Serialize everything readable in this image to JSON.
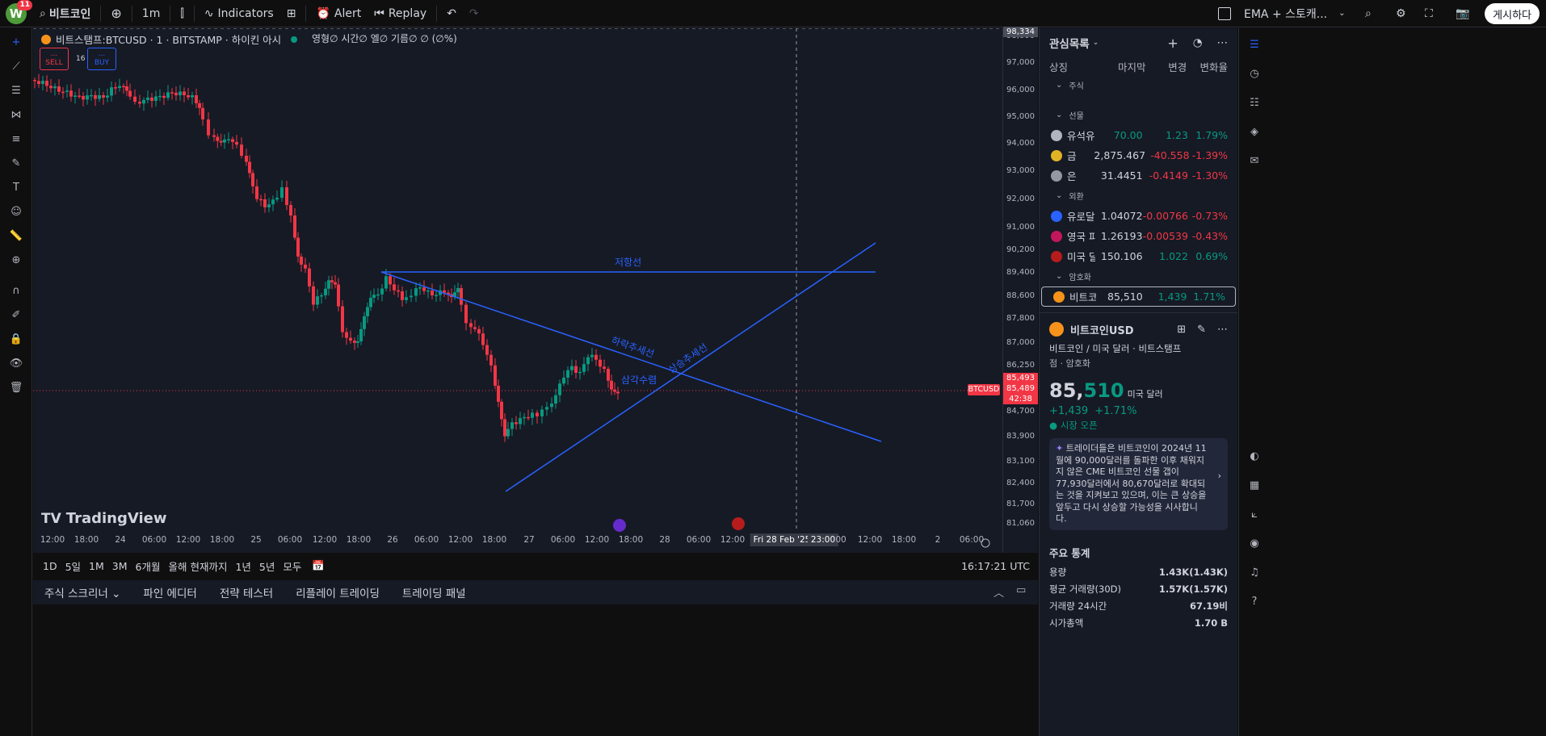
{
  "topbar": {
    "avatar_letter": "W",
    "notif_count": "11",
    "symbol": "비트코인",
    "interval": "1m",
    "indicators": "Indicators",
    "alert": "Alert",
    "replay": "Replay",
    "template": "EMA + 스토캐...",
    "publish": "게시하다"
  },
  "chart": {
    "title": "비트스탬프:BTCUSD · 1 · BITSTAMP · 하이킨 아시",
    "ohlc_label": "영형∅ 시간∅ 엘∅ 기름∅ ∅ (∅%)",
    "sell_label": "SELL",
    "buy_label": "BUY",
    "sell_dots": "...",
    "buy_dots": "...",
    "spread": "16",
    "logo_text": "TradingView",
    "price_ticks": [
      "98,000",
      "97,000",
      "96,000",
      "95,000",
      "94,000",
      "93,000",
      "92,000",
      "91,000",
      "90,200",
      "89,400",
      "88,600",
      "87,800",
      "87,000",
      "86,250",
      "84,700",
      "83,900",
      "83,100",
      "82,400",
      "81,700",
      "81,060"
    ],
    "top_price": "98,334",
    "current_symbol_tag": "BTCUSD",
    "price_a": "85,493",
    "price_b": "85,489",
    "countdown": "42:38",
    "time_ticks": [
      "12:00",
      "18:00",
      "24",
      "06:00",
      "12:00",
      "18:00",
      "25",
      "06:00",
      "12:00",
      "18:00",
      "26",
      "06:00",
      "12:00",
      "18:00",
      "27",
      "06:00",
      "12:00",
      "18:00",
      "28",
      "06:00",
      "12:00",
      "Fri 28 Feb '25",
      "23:00",
      "00",
      "12:00",
      "18:00",
      "2",
      "06:00"
    ],
    "annotations": {
      "resistance": "저항선",
      "downtrend": "하락추세선",
      "uptrend": "상승추세선",
      "triangle": "삼각수렴"
    }
  },
  "rangebar": {
    "ranges": [
      "1D",
      "5일",
      "1M",
      "3M",
      "6개월",
      "올해 현재까지",
      "1년",
      "5년",
      "모두"
    ],
    "clock": "16:17:21 UTC"
  },
  "bottomtabs": [
    "주식 스크리너",
    "파인 에디터",
    "전략 테스터",
    "리플레이 트레이딩",
    "트레이딩 패널"
  ],
  "watchlist": {
    "title": "관심목록",
    "cols": [
      "상징",
      "마지막",
      "변경",
      "변화율"
    ],
    "sections": {
      "stocks": "주식",
      "futures": "선물",
      "forex": "외환",
      "crypto": "암호화"
    },
    "futures": [
      {
        "sym": "유석유",
        "last": "70.00",
        "chg": "1.23",
        "chp": "1.79%",
        "color": "#089981",
        "icon": "#b2b5be"
      },
      {
        "sym": "금",
        "last": "2,875.467",
        "chg": "-40.558",
        "chp": "-1.39%",
        "color": "#f23645",
        "icon": "#e0b324"
      },
      {
        "sym": "은",
        "last": "31.4451",
        "chg": "-0.4149",
        "chp": "-1.30%",
        "color": "#f23645",
        "icon": "#9598a1"
      }
    ],
    "forex": [
      {
        "sym": "유로달러",
        "last": "1.04072",
        "chg": "-0.00766",
        "chp": "-0.73%",
        "color": "#f23645",
        "icon": "#2962ff"
      },
      {
        "sym": "영국 파운드",
        "last": "1.26193",
        "chg": "-0.00539",
        "chp": "-0.43%",
        "color": "#f23645",
        "icon": "#c2185b"
      },
      {
        "sym": "미국 달러",
        "last": "150.106",
        "chg": "1.022",
        "chp": "0.69%",
        "color": "#089981",
        "icon": "#b71c1c"
      }
    ],
    "crypto": [
      {
        "sym": "비트코인",
        "last": "85,510",
        "chg": "1,439",
        "chp": "1.71%",
        "color": "#089981",
        "icon": "#f7931a"
      }
    ]
  },
  "detail": {
    "name": "비트코인USD",
    "sub": "비트코인 / 미국 달러 · 비트스탬프",
    "category": "점 · 암호화",
    "price_main": "85,",
    "price_frac": "510",
    "currency": "미국 달러",
    "change": "+1,439",
    "change_pct": "+1.71%",
    "market_status": "시장 오픈",
    "ai_text": "트레이더들은 비트코인이 2024년 11월에 90,000달러를 돌파한 이후 채워지지 않은 CME 비트코인 선물 갭이 77,930달러에서 80,670달러로 확대되는 것을 지켜보고 있으며, 이는 큰 상승을 앞두고 다시 상승할 가능성을 시사합니다.",
    "stats_title": "주요 통계",
    "stats": [
      {
        "label": "용량",
        "value": "1.43K(1.43K)"
      },
      {
        "label": "평균 거래량(30D)",
        "value": "1.57K(1.57K)"
      },
      {
        "label": "거래량 24시간",
        "value": "67.19비"
      },
      {
        "label": "시가총액",
        "value": "1.70 B"
      }
    ]
  },
  "colors": {
    "up": "#089981",
    "down": "#f23645",
    "drawing": "#2962ff",
    "chart_bg": "#161a25"
  }
}
